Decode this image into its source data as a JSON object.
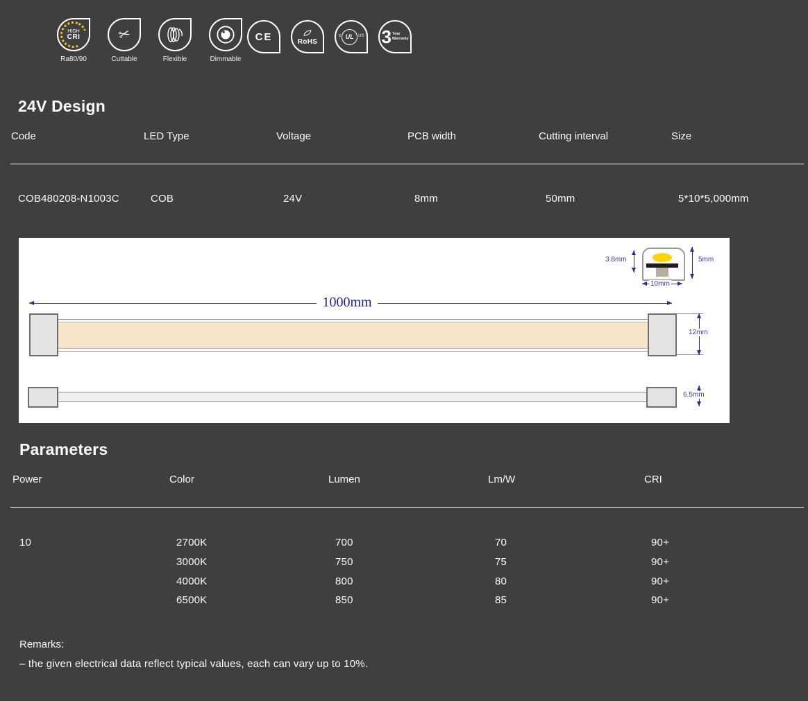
{
  "page": {
    "background": "#3f3f3f",
    "text_color": "#fafafa",
    "dimension_color": "#2a2aa8"
  },
  "feature_badges": [
    {
      "label": "Ra80/90",
      "icon": "high-cri",
      "line1": "HIGH",
      "line2": "CRI"
    },
    {
      "label": "Cuttable",
      "icon": "scissors"
    },
    {
      "label": "Flexible",
      "icon": "coil"
    },
    {
      "label": "Dimmable",
      "icon": "dimmer-knob"
    }
  ],
  "cert_badges": {
    "ce": "CE",
    "rohs": "RoHS",
    "ul": {
      "left": "c",
      "center": "UL",
      "right": "US"
    },
    "warranty": {
      "number": "3",
      "line1": "Year",
      "line2": "Warranty"
    }
  },
  "design_section": {
    "title": "24V Design",
    "columns": [
      "Code",
      "LED Type",
      "Voltage",
      "PCB width",
      "Cutting interval",
      "Size"
    ],
    "row": [
      "COB480208-N1003C",
      "COB",
      "24V",
      "8mm",
      "50mm",
      "5*10*5,000mm"
    ]
  },
  "diagram": {
    "length_label": "1000mm",
    "front_height_label": "12mm",
    "side_height_label": "6.5mm",
    "cross_section": {
      "left_label": "3.8mm",
      "right_label": "5mm",
      "bottom_label": "10mm"
    },
    "strip_fill_color": "#f8e4c8",
    "led_color": "#ffd400"
  },
  "parameters_section": {
    "title": "Parameters",
    "columns": [
      "Power",
      "Color",
      "Lumen",
      "Lm/W",
      "CRI"
    ],
    "power": "10",
    "rows": [
      [
        "2700K",
        "700",
        "70",
        "90+"
      ],
      [
        "3000K",
        "750",
        "75",
        "90+"
      ],
      [
        "4000K",
        "800",
        "80",
        "90+"
      ],
      [
        "6500K",
        "850",
        "85",
        "90+"
      ]
    ]
  },
  "remarks": {
    "title": "Remarks:",
    "line1": "– the given electrical data reflect typical values, each can vary up to 10%."
  }
}
